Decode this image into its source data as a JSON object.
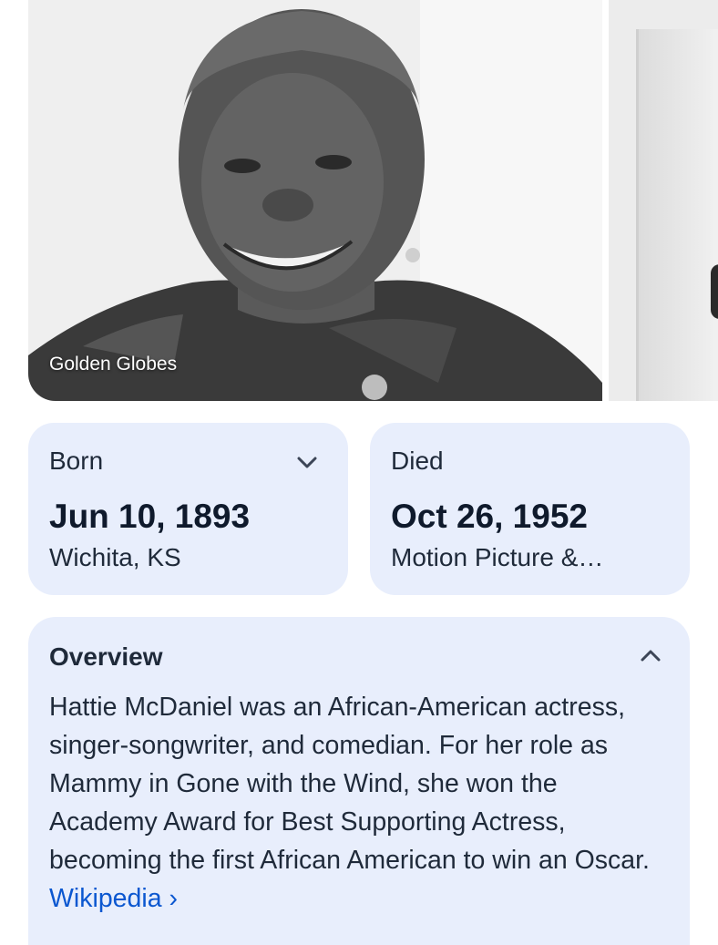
{
  "photo": {
    "caption": "Golden Globes"
  },
  "born": {
    "label": "Born",
    "date": "Jun 10, 1893",
    "place": "Wichita, KS",
    "icon": "chevron-down-icon"
  },
  "died": {
    "label": "Died",
    "date": "Oct 26, 1952",
    "place": "Motion Picture &…"
  },
  "overview": {
    "title": "Overview",
    "text": "Hattie McDaniel was an African-American actress, singer-songwriter, and comedian. For her role as Mammy in Gone with the Wind, she won the Academy Award for Best Supporting Actress, becoming the first African American to win an Oscar. ",
    "link_label": "Wikipedia ›",
    "icon": "chevron-up-icon"
  },
  "colors": {
    "card_bg": "#e8eefc",
    "link": "#0b57d0",
    "text": "#1f2a3a"
  }
}
